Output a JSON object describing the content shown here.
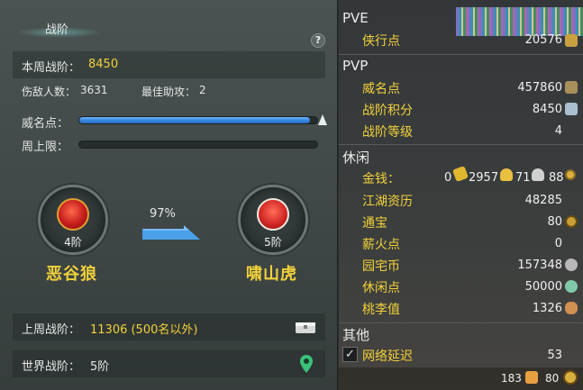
{
  "left": {
    "title": "战阶",
    "help_label": "?",
    "week_rank_label": "本周战阶：",
    "week_rank_value": "8450",
    "kills_label": "伤敌人数：",
    "kills_value": "3631",
    "best_assist_label": "最佳助攻：",
    "best_assist_value": "2",
    "prestige_label": "威名点：",
    "prestige_progress": 0.97,
    "week_cap_label": "周上限：",
    "week_cap_progress": 0.0,
    "progress_percent": "97%",
    "current_rank": {
      "level": "4阶",
      "name": "恶谷狼"
    },
    "next_rank": {
      "level": "5阶",
      "name": "啸山虎"
    },
    "last_week_label": "上周战阶：",
    "last_week_value": "11306 (500名以外)",
    "world_rank_label": "世界战阶：",
    "world_rank_value": "5阶"
  },
  "right": {
    "pve": {
      "header": "PVE",
      "items": [
        {
          "label": "侠行点",
          "value": "20576"
        }
      ]
    },
    "pvp": {
      "header": "PVP",
      "items": [
        {
          "label": "威名点",
          "value": "457860"
        },
        {
          "label": "战阶积分",
          "value": "8450"
        },
        {
          "label": "战阶等级",
          "value": "4"
        }
      ]
    },
    "leisure": {
      "header": "休闲",
      "money_label": "金钱：",
      "money_gold_bars": "0",
      "money_gold": "2957",
      "money_silver": "71",
      "money_copper": "88",
      "items": [
        {
          "label": "江湖资历",
          "value": "48285"
        },
        {
          "label": "通宝",
          "value": "80"
        },
        {
          "label": "薪火点",
          "value": "0"
        },
        {
          "label": "园宅币",
          "value": "157348"
        },
        {
          "label": "休闲点",
          "value": "50000"
        },
        {
          "label": "桃李值",
          "value": "1326"
        }
      ]
    },
    "other": {
      "header": "其他",
      "latency_label": "网络延迟",
      "latency_value": "53",
      "checkbox_mark": "✓"
    },
    "bottom": {
      "count_a": "183",
      "count_b": "80"
    }
  },
  "colors": {
    "accent_yellow": "#f2d23a",
    "bar_blue": "#3a86e0",
    "background": "#414a49"
  }
}
